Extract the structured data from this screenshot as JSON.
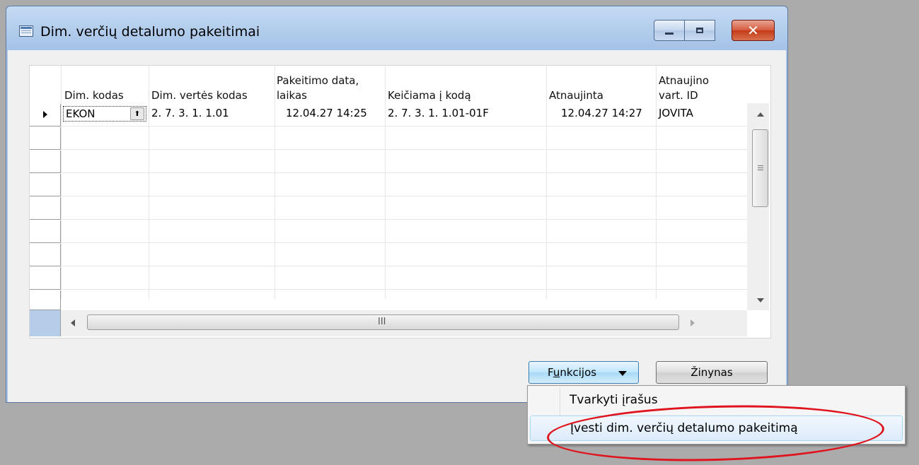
{
  "window": {
    "title": "Dim. verčių detalumo pakeitimai"
  },
  "grid": {
    "columns": [
      {
        "line1": "",
        "line2": "Dim. kodas"
      },
      {
        "line1": "",
        "line2": "Dim. vertės kodas"
      },
      {
        "line1": "Pakeitimo data,",
        "line2": "laikas"
      },
      {
        "line1": "",
        "line2": "Keičiama į kodą"
      },
      {
        "line1": "",
        "line2": "Atnaujinta"
      },
      {
        "line1": "Atnaujino",
        "line2": "vart. ID"
      }
    ],
    "rows": [
      {
        "dim_code": "EKON",
        "dim_value_code": "2. 7. 3. 1. 1.01",
        "change_datetime": "12.04.27 14:25",
        "new_code": "2. 7. 3. 1. 1.01-01F",
        "updated": "12.04.27 14:27",
        "user_id": "JOVITA"
      }
    ],
    "hscroll_grip": "III"
  },
  "buttons": {
    "functions_prefix": "F",
    "functions_accel": "u",
    "functions_suffix": "nkcijos",
    "help": "Žinynas"
  },
  "menu": {
    "items": [
      {
        "label": "Tvarkyti įrašus"
      },
      {
        "label": "Įvesti dim. verčių detalumo pakeitimą"
      }
    ]
  },
  "colors": {
    "annotation": "#e0141e",
    "background": "#ababab"
  }
}
